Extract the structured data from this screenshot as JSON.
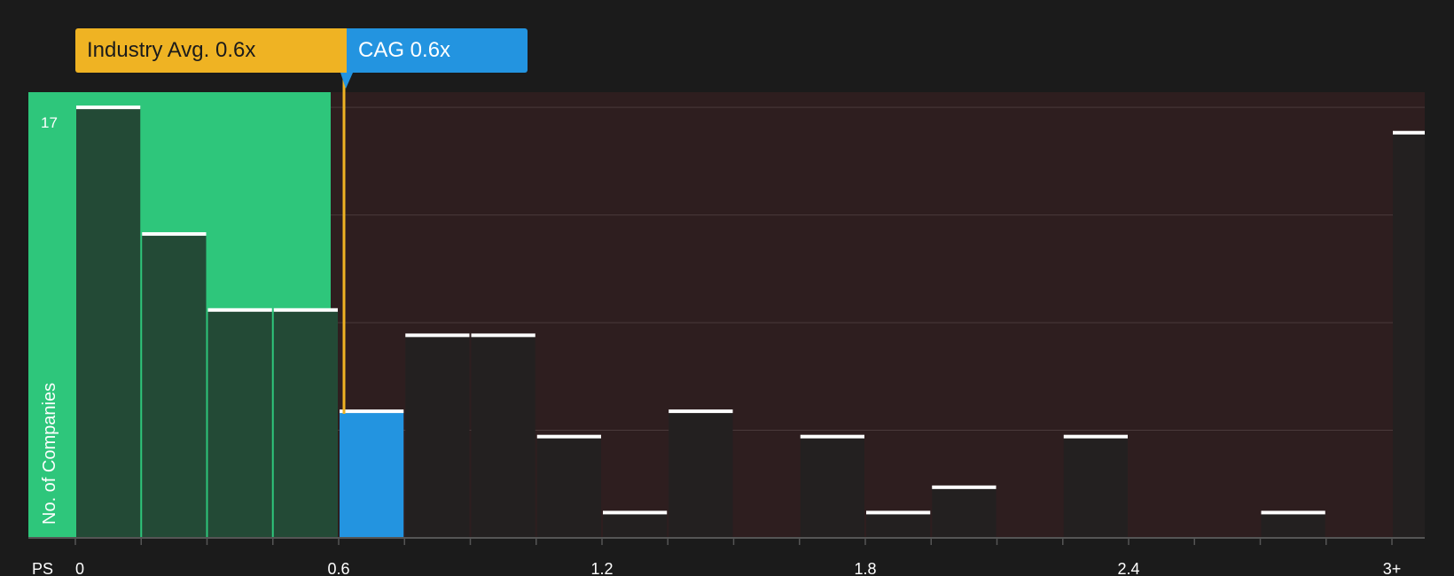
{
  "chart_data": {
    "type": "bar",
    "x_label": "PS",
    "y_label": "No. of Companies",
    "y_max_label": "17",
    "ylim": [
      0,
      17.6
    ],
    "x_ticks": [
      "0",
      "0.6",
      "1.2",
      "1.8",
      "2.4",
      "3+"
    ],
    "bin_width": 0.15,
    "bins": [
      {
        "start": 0.0,
        "value": 17,
        "group": "below"
      },
      {
        "start": 0.15,
        "value": 12,
        "group": "below"
      },
      {
        "start": 0.3,
        "value": 9,
        "group": "below"
      },
      {
        "start": 0.45,
        "value": 9,
        "group": "below"
      },
      {
        "start": 0.6,
        "value": 5,
        "group": "company"
      },
      {
        "start": 0.75,
        "value": 8,
        "group": "above"
      },
      {
        "start": 0.9,
        "value": 8,
        "group": "above"
      },
      {
        "start": 1.05,
        "value": 4,
        "group": "above"
      },
      {
        "start": 1.2,
        "value": 1,
        "group": "above"
      },
      {
        "start": 1.35,
        "value": 5,
        "group": "above"
      },
      {
        "start": 1.5,
        "value": 0,
        "group": "above"
      },
      {
        "start": 1.65,
        "value": 4,
        "group": "above"
      },
      {
        "start": 1.8,
        "value": 1,
        "group": "above"
      },
      {
        "start": 1.95,
        "value": 2,
        "group": "above"
      },
      {
        "start": 2.1,
        "value": 0,
        "group": "above"
      },
      {
        "start": 2.25,
        "value": 4,
        "group": "above"
      },
      {
        "start": 2.4,
        "value": 0,
        "group": "above"
      },
      {
        "start": 2.55,
        "value": 0,
        "group": "above"
      },
      {
        "start": 2.7,
        "value": 1,
        "group": "above"
      },
      {
        "start": 2.85,
        "value": 0,
        "group": "above"
      },
      {
        "start": 3.0,
        "value": 16,
        "group": "above"
      }
    ],
    "industry_avg": {
      "label": "Industry Avg. 0.6x",
      "value": 0.62,
      "color": "#efb323"
    },
    "company": {
      "label": "CAG 0.6x",
      "value": 0.6,
      "color": "#2394e0"
    },
    "colors": {
      "below_region": "#2ec67b",
      "above_region": "#2e1e1f",
      "bar_below": "#234a36",
      "bar_above": "#232020",
      "bar_company": "#2394e0",
      "cap": "#ffffff"
    }
  }
}
